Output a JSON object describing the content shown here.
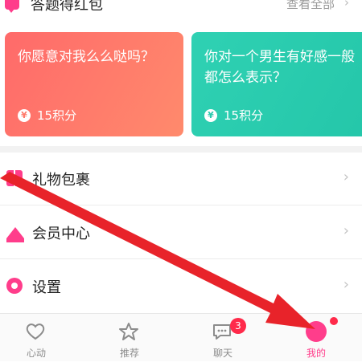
{
  "section": {
    "title": "答题得红包",
    "more_label": "查看全部",
    "chevron": "›"
  },
  "cards": [
    {
      "question": "你愿意对我么么哒吗？",
      "coin_symbol": "¥",
      "reward": "15积分"
    },
    {
      "question": "你对一个男生有好感一般都怎么表示？",
      "coin_symbol": "¥",
      "reward": "15积分"
    }
  ],
  "menu": {
    "items": [
      {
        "label": "礼物包裹",
        "icon": "gift-icon"
      },
      {
        "label": "会员中心",
        "icon": "crown-icon"
      },
      {
        "label": "设置",
        "icon": "gear-icon"
      }
    ],
    "chevron": "›"
  },
  "tabbar": {
    "tabs": [
      {
        "label": "心动",
        "icon": "heart-icon"
      },
      {
        "label": "推荐",
        "icon": "star-icon"
      },
      {
        "label": "聊天",
        "icon": "chat-icon",
        "badge": "3"
      },
      {
        "label": "我的",
        "icon": "profile-icon",
        "active": true
      }
    ]
  },
  "colors": {
    "accent": "#ff3d8b",
    "card1": "#ff7a6b",
    "card2": "#2bc9ad",
    "badge": "#ff2a4a",
    "annotation_arrow": "#e8232a"
  }
}
